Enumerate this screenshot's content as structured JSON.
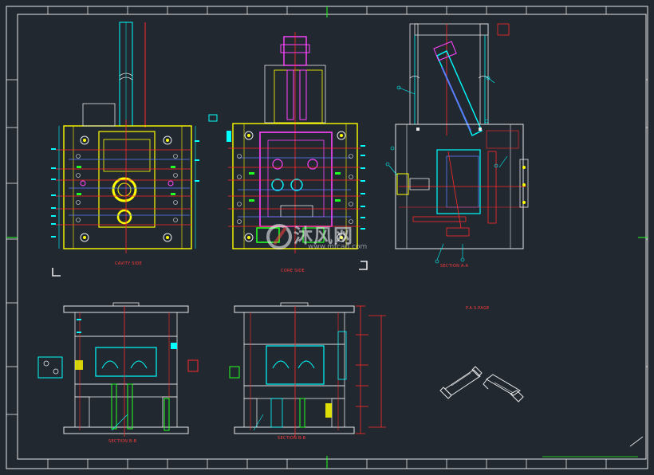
{
  "drawing": {
    "view_labels": {
      "cavity_side": "CAVITY SIDE",
      "core_side": "CORE SIDE",
      "section_aa": "SECTION A-A",
      "section_bb_left": "SECTION B-B",
      "section_bb_right": "SECTION B-B",
      "parts_note": "P.A.S.PAGE"
    },
    "watermark": {
      "brand_cn": "沐风网",
      "site": "www.mfcad.com"
    },
    "colors": {
      "background": "#212830",
      "frame": "#ffffff",
      "plate": "#ffff00",
      "cyan": "#00ffff",
      "red": "#ff2a2a",
      "magenta": "#ff44ff",
      "green": "#22ff22",
      "blue": "#5a7cff"
    }
  }
}
